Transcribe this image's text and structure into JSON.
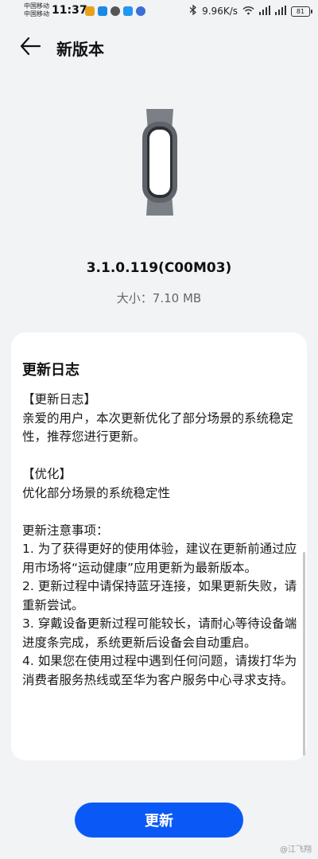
{
  "status_bar": {
    "carrier_1": "中国移动",
    "carrier_2": "中国移动",
    "time": "11:37",
    "net_speed": "9.96K/s",
    "battery": "81"
  },
  "header": {
    "title": "新版本"
  },
  "version_info": {
    "version": "3.1.0.119(C00M03)",
    "size_label": "大小：",
    "size_value": "7.10 MB"
  },
  "changelog": {
    "title": "更新日志",
    "section1_heading": "【更新日志】",
    "section1_body": "亲爱的用户，本次更新优化了部分场景的系统稳定性，推荐您进行更新。",
    "section2_heading": "【优化】",
    "section2_body": "优化部分场景的系统稳定性",
    "notes_heading": "更新注意事项：",
    "notes": [
      "1. 为了获得更好的使用体验，建议在更新前通过应用市场将“运动健康”应用更新为最新版本。",
      "2. 更新过程中请保持蓝牙连接，如果更新失败，请重新尝试。",
      "3. 穿戴设备更新过程可能较长，请耐心等待设备端进度条完成，系统更新后设备会自动重启。",
      "4. 如果您在使用过程中遇到任何问题，请拨打华为消费者服务热线或至华为客户服务中心寻求支持。"
    ]
  },
  "actions": {
    "update_label": "更新"
  },
  "watermark": "@江飞翔",
  "colors": {
    "accent": "#0a59f7",
    "background": "#f1f3f5",
    "card": "#ffffff"
  }
}
